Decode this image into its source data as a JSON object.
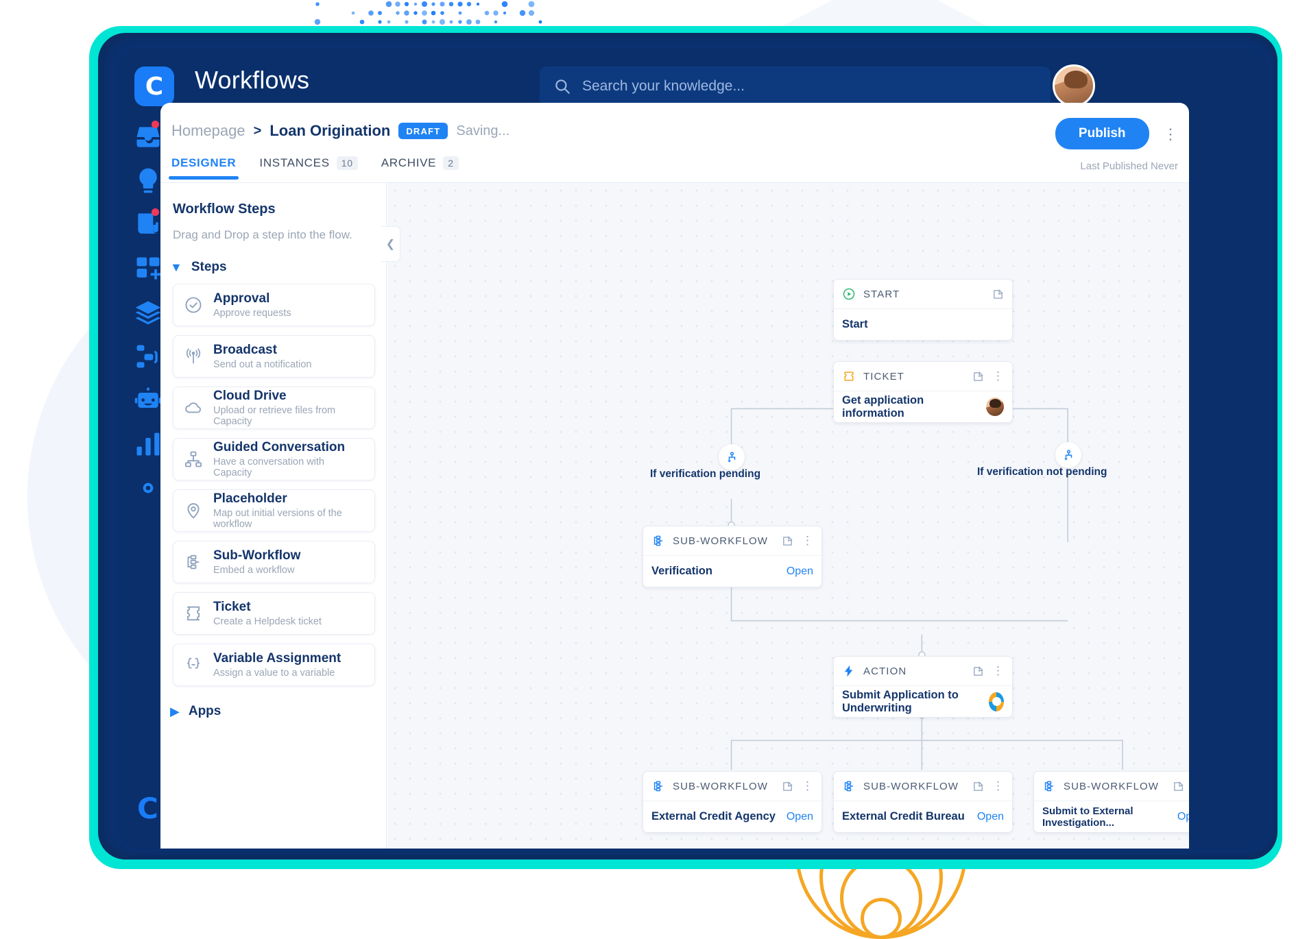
{
  "header": {
    "app_title": "Workflows",
    "logo_letter": "C",
    "search": {
      "placeholder": "Search your knowledge...",
      "icon": "search-icon"
    },
    "avatar": "user-avatar"
  },
  "breadcrumb": {
    "home": "Homepage",
    "separator": ">",
    "current": "Loan Origination",
    "status_badge": "DRAFT",
    "saving_text": "Saving..."
  },
  "actions": {
    "publish_label": "Publish",
    "kebab": "more-options-icon",
    "last_published": "Last Published Never"
  },
  "tabs": [
    {
      "label": "DESIGNER",
      "count": "",
      "active": true
    },
    {
      "label": "INSTANCES",
      "count": "10",
      "active": false
    },
    {
      "label": "ARCHIVE",
      "count": "2",
      "active": false
    }
  ],
  "panel": {
    "title": "Workflow Steps",
    "subtitle": "Drag and Drop a step into the flow.",
    "group_label": "Steps",
    "apps_label": "Apps",
    "steps": [
      {
        "name": "Approval",
        "desc": "Approve requests",
        "icon": "check-circle-icon"
      },
      {
        "name": "Broadcast",
        "desc": "Send out a notification",
        "icon": "broadcast-icon"
      },
      {
        "name": "Cloud Drive",
        "desc": "Upload or retrieve files from Capacity",
        "icon": "cloud-icon"
      },
      {
        "name": "Guided Conversation",
        "desc": "Have a conversation with Capacity",
        "icon": "sitemap-icon"
      },
      {
        "name": "Placeholder",
        "desc": "Map out initial versions of the workflow",
        "icon": "map-pin-icon"
      },
      {
        "name": "Sub-Workflow",
        "desc": "Embed a workflow",
        "icon": "sub-workflow-icon"
      },
      {
        "name": "Ticket",
        "desc": "Create a Helpdesk ticket",
        "icon": "ticket-icon"
      },
      {
        "name": "Variable Assignment",
        "desc": "Assign a value to a variable",
        "icon": "braces-icon"
      }
    ]
  },
  "canvas": {
    "nodes": [
      {
        "type": "START",
        "label": "Start",
        "type_icon": "play-circle-icon",
        "open_label": "",
        "has_kebab": false,
        "right": ""
      },
      {
        "type": "TICKET",
        "label": "Get application information",
        "type_icon": "ticket-icon",
        "open_label": "",
        "has_kebab": true,
        "right": "assignee-avatar"
      },
      {
        "type": "SUB-WORKFLOW",
        "label": "Verification",
        "type_icon": "sub-workflow-icon",
        "open_label": "Open",
        "has_kebab": true,
        "right": ""
      },
      {
        "type": "ACTION",
        "label": "Submit Application to Underwriting",
        "type_icon": "lightning-icon",
        "open_label": "",
        "has_kebab": true,
        "right": "app-badge"
      },
      {
        "type": "SUB-WORKFLOW",
        "label": "External Credit Agency",
        "type_icon": "sub-workflow-icon",
        "open_label": "Open",
        "has_kebab": true,
        "right": ""
      },
      {
        "type": "SUB-WORKFLOW",
        "label": "External Credit Bureau",
        "type_icon": "sub-workflow-icon",
        "open_label": "Open",
        "has_kebab": true,
        "right": ""
      },
      {
        "type": "SUB-WORKFLOW",
        "label": "Submit to External Investigation...",
        "type_icon": "sub-workflow-icon",
        "open_label": "Open",
        "has_kebab": true,
        "right": ""
      }
    ],
    "branches": [
      {
        "label": "If verification pending"
      },
      {
        "label": "If verification not pending"
      }
    ]
  },
  "rail": {
    "items": [
      {
        "icon": "inbox-icon",
        "badge": true
      },
      {
        "icon": "lightbulb-icon",
        "badge": false
      },
      {
        "icon": "document-icon",
        "badge": true
      },
      {
        "icon": "apps-add-icon",
        "badge": false
      },
      {
        "icon": "layers-icon",
        "badge": false
      },
      {
        "icon": "workflow-icon",
        "badge": false
      },
      {
        "icon": "robot-icon",
        "badge": false
      },
      {
        "icon": "analytics-icon",
        "badge": false
      },
      {
        "icon": "gear-icon",
        "badge": false
      }
    ],
    "brand_letter": "C"
  },
  "colors": {
    "accent": "#2083f4",
    "navy": "#0a2f6b",
    "teal": "#00e5d4",
    "orange": "#f5a623",
    "green": "#2eb872"
  }
}
